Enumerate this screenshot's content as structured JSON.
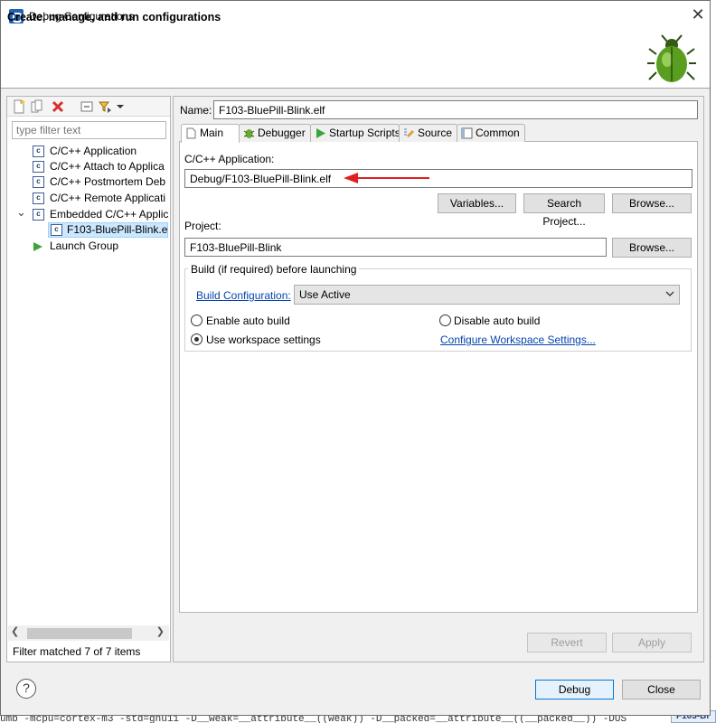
{
  "window": {
    "title": "Debug Configurations",
    "close_glyph": "✕"
  },
  "header": {
    "title": "Create, manage, and run configurations"
  },
  "left": {
    "filter_placeholder": "type filter text",
    "tree": [
      {
        "label": "C/C++ Application",
        "icon": "c-config-icon"
      },
      {
        "label": "C/C++ Attach to Applica",
        "icon": "c-config-icon"
      },
      {
        "label": "C/C++ Postmortem Deb",
        "icon": "c-config-icon"
      },
      {
        "label": "C/C++ Remote Applicati",
        "icon": "c-config-icon"
      },
      {
        "label": "Embedded C/C++ Applic",
        "icon": "c-config-icon",
        "expanded": true
      },
      {
        "label": "F103-BluePill-Blink.elf",
        "icon": "c-config-icon",
        "selected": true
      },
      {
        "label": "Launch Group",
        "icon": "launch-group-icon"
      }
    ],
    "expand_glyph": "⌄",
    "c_glyph": "c",
    "filter_status": "Filter matched 7 of 7 items"
  },
  "right": {
    "name_label": "Name:",
    "name_value": "F103-BluePill-Blink.elf",
    "tabs": [
      {
        "label": "Main",
        "icon": "main-tab-icon"
      },
      {
        "label": "Debugger",
        "icon": "debugger-tab-icon"
      },
      {
        "label": "Startup Scripts",
        "icon": "startup-tab-icon"
      },
      {
        "label": "Source",
        "icon": "source-tab-icon"
      },
      {
        "label": "Common",
        "icon": "common-tab-icon"
      }
    ],
    "cpp_app_label": "C/C++ Application:",
    "cpp_app_value": "Debug/F103-BluePill-Blink.elf",
    "variables_button": "Variables...",
    "search_project_button": "Search Project...",
    "browse_button": "Browse...",
    "project_label": "Project:",
    "project_value": "F103-BluePill-Blink",
    "browse_button_2": "Browse...",
    "build_group_title": "Build (if required) before launching",
    "build_config_link": "Build Configuration:",
    "build_config_value": "Use Active",
    "enable_auto_build": "Enable auto build",
    "disable_auto_build": "Disable auto build",
    "use_workspace_settings": "Use workspace settings",
    "configure_workspace_link": "Configure Workspace Settings...",
    "selected_build_option": "use_workspace_settings",
    "revert_button": "Revert",
    "apply_button": "Apply",
    "annotation_arrow_color": "#e02020"
  },
  "footer": {
    "help_glyph": "?",
    "debug_button": "Debug",
    "close_button": "Close"
  },
  "background": {
    "code_text": "umb -mcpu=cortex-m3 -std=gnu11 -D__weak=__attribute__((weak)) -D__packed=__attribute__((__packed__)) -DUS",
    "tab_text": "F103-Bl"
  }
}
